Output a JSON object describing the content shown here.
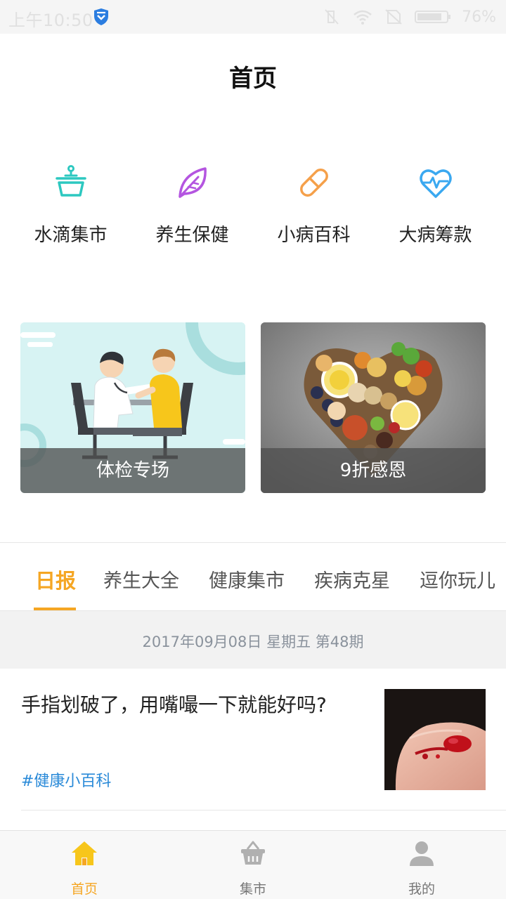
{
  "status_bar": {
    "time": "上午10:50",
    "battery": "76%"
  },
  "header": {
    "title": "首页"
  },
  "categories": [
    {
      "label": "水滴集市",
      "icon": "basket-icon",
      "color": "#2dc8c0"
    },
    {
      "label": "养生保健",
      "icon": "leaf-icon",
      "color": "#b455e0"
    },
    {
      "label": "小病百科",
      "icon": "pill-icon",
      "color": "#f5a04a"
    },
    {
      "label": "大病筹款",
      "icon": "heart-pulse-icon",
      "color": "#3aa8f0"
    }
  ],
  "banners": [
    {
      "caption": "体检专场",
      "image": "doctor-checkup-illustration"
    },
    {
      "caption": "9折感恩",
      "image": "heart-shaped-food-photo"
    }
  ],
  "tabs": {
    "items": [
      "日报",
      "养生大全",
      "健康集市",
      "疾病克星",
      "逗你玩儿"
    ],
    "active_index": 0,
    "active_color": "#f5a623"
  },
  "date_strip": {
    "text": "2017年09月08日 星期五 第48期"
  },
  "articles": [
    {
      "headline": "手指划破了，用嘴嘬一下就能好吗?",
      "tag": "#健康小百科",
      "tag_color": "#2a8ad8",
      "thumbnail": "bleeding-finger-photo"
    }
  ],
  "bottom_nav": [
    {
      "label": "首页",
      "icon": "home-icon",
      "active": true
    },
    {
      "label": "集市",
      "icon": "basket-icon",
      "active": false
    },
    {
      "label": "我的",
      "icon": "user-icon",
      "active": false
    }
  ]
}
